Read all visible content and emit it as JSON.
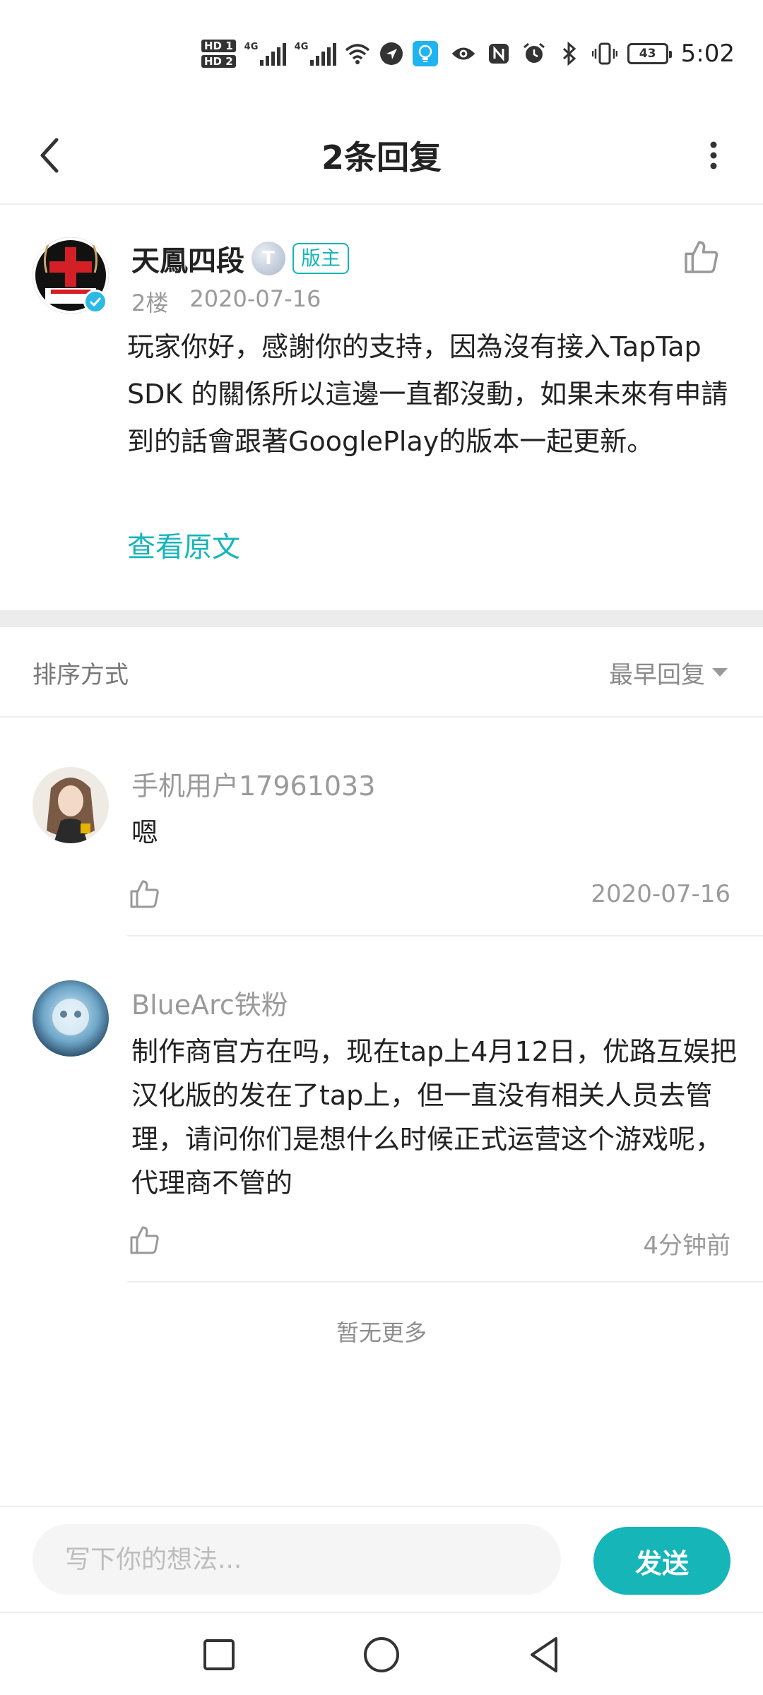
{
  "status_bar": {
    "hd1": "HD 1",
    "hd2": "HD 2",
    "net1": "4G",
    "net2": "4G",
    "battery": "43",
    "time": "5:02"
  },
  "header": {
    "title": "2条回复",
    "back_icon": "chevron-left-icon",
    "more_icon": "more-vertical-icon"
  },
  "main_post": {
    "author": "天鳳四段",
    "level_badge": "T",
    "role_badge": "版主",
    "floor": "2楼",
    "date": "2020-07-16",
    "body": "玩家你好，感謝你的支持，因為沒有接入TapTap SDK 的關係所以這邊一直都沒動，如果未來有申請到的話會跟著GooglePlay的版本一起更新。",
    "view_original": "查看原文"
  },
  "sort": {
    "label": "排序方式",
    "selected": "最早回复"
  },
  "replies": [
    {
      "name": "手机用户17961033",
      "text": "嗯",
      "time": "2020-07-16"
    },
    {
      "name": "BlueArc铁粉",
      "text": "制作商官方在吗，现在tap上4月12日，优路互娱把汉化版的发在了tap上，但一直没有相关人员去管理，请问你们是想什么时候正式运营这个游戏呢，代理商不管的",
      "time": "4分钟前"
    }
  ],
  "no_more": "暂无更多",
  "composer": {
    "placeholder": "写下你的想法...",
    "send": "发送"
  },
  "colors": {
    "accent": "#15b5b8",
    "muted": "#9a9a9a",
    "divider": "#eeeeee"
  }
}
